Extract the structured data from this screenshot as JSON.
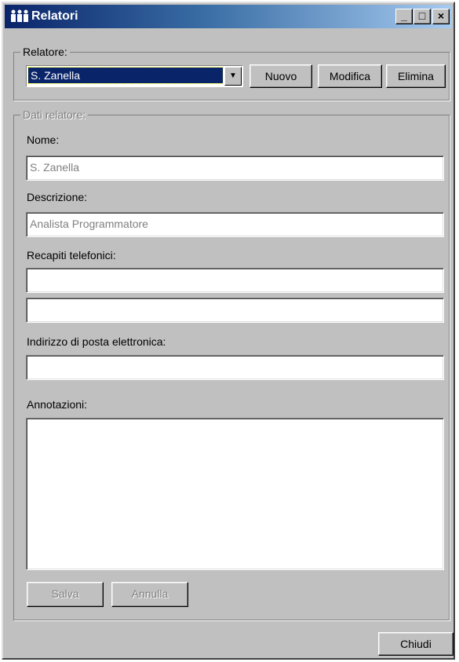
{
  "window": {
    "title": "Relatori",
    "icon": "people-icon",
    "controls": {
      "minimize": "_",
      "maximize": "□",
      "close": "×"
    }
  },
  "selector": {
    "legend": "Relatore:",
    "selected": "S. Zanella",
    "new_label": "Nuovo",
    "edit_label": "Modifica",
    "delete_label": "Elimina"
  },
  "details": {
    "legend": "Dati relatore:",
    "name_label": "Nome:",
    "name_value": "S. Zanella",
    "description_label": "Descrizione:",
    "description_value": "Analista Programmatore",
    "phones_label": "Recapiti telefonici:",
    "phone1_value": "",
    "phone2_value": "",
    "email_label": "Indirizzo di posta elettronica:",
    "email_value": "",
    "notes_label": "Annotazioni:",
    "notes_value": "",
    "save_label": "Salva",
    "cancel_label": "Annulla"
  },
  "footer": {
    "close_label": "Chiudi"
  },
  "colors": {
    "face": "#c0c0c0",
    "title_start": "#0a246a",
    "title_end": "#a6caf0",
    "selection": "#0a246a",
    "disabled_text": "#808080"
  }
}
